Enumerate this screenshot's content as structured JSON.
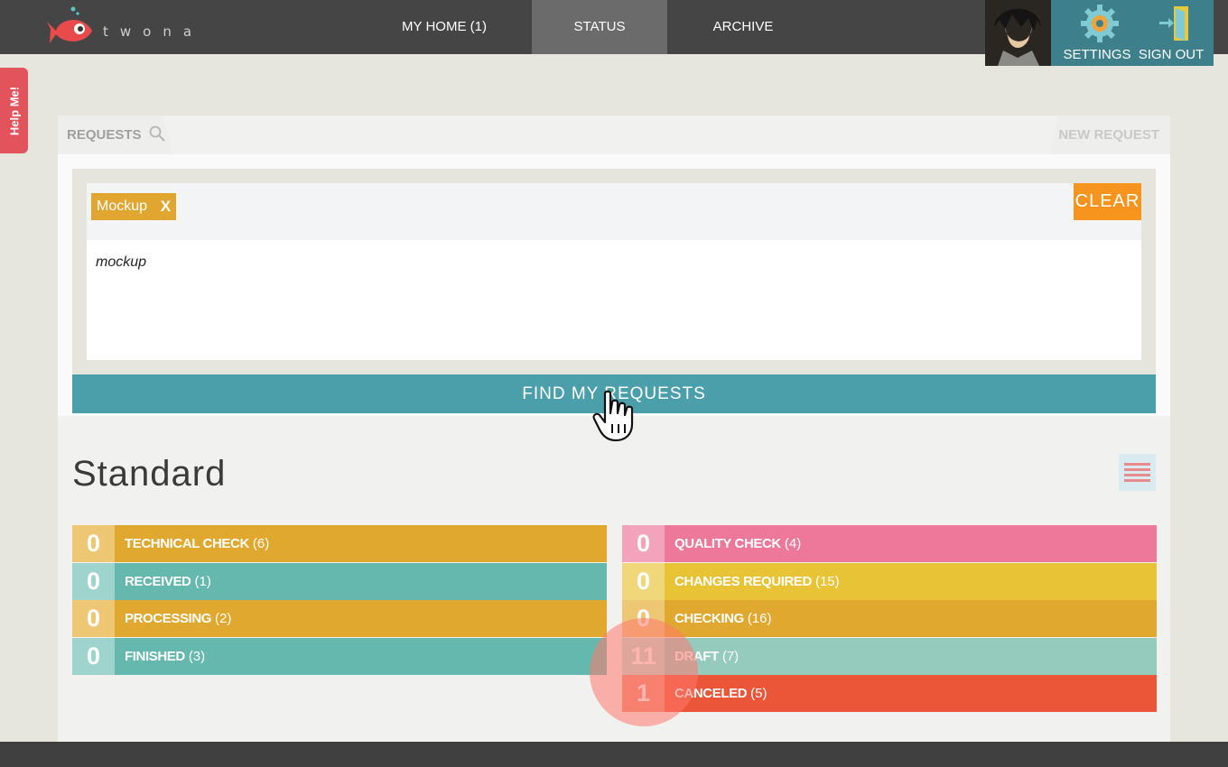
{
  "brand": {
    "name": "twona"
  },
  "nav": [
    {
      "label": "MY HOME (1)"
    },
    {
      "label": "STATUS"
    },
    {
      "label": "ARCHIVE"
    }
  ],
  "user_menu": {
    "settings": "SETTINGS",
    "sign_out": "SIGN OUT"
  },
  "help_tab": "Help Me!",
  "tabs": {
    "requests": "REQUESTS",
    "new_request": "NEW REQUEST"
  },
  "search": {
    "tag": "Mockup",
    "tag_remove": "X",
    "clear_label": "CLEAR",
    "query": "mockup",
    "find_label": "FIND MY REQUESTS"
  },
  "section_title": "Standard",
  "statuses_left": [
    {
      "count": "0",
      "name": "TECHNICAL CHECK",
      "total": "(6)",
      "color": "#e0a82e",
      "count_color": "#eec774"
    },
    {
      "count": "0",
      "name": "RECEIVED",
      "total": "(1)",
      "color": "#64b8ad",
      "count_color": "#9ed4cd"
    },
    {
      "count": "0",
      "name": "PROCESSING",
      "total": "(2)",
      "color": "#e0a82e",
      "count_color": "#eec774"
    },
    {
      "count": "0",
      "name": "FINISHED",
      "total": "(3)",
      "color": "#64b8ad",
      "count_color": "#9ed4cd"
    }
  ],
  "statuses_right": [
    {
      "count": "0",
      "name": "QUALITY CHECK",
      "total": "(4)",
      "color": "#ee7899",
      "count_color": "#f3a3bb"
    },
    {
      "count": "0",
      "name": "CHANGES REQUIRED",
      "total": "(15)",
      "color": "#e8c335",
      "count_color": "#f0d87a"
    },
    {
      "count": "0",
      "name": "CHECKING",
      "total": "(16)",
      "color": "#e0a82e",
      "count_color": "#eec774"
    },
    {
      "count": "11",
      "name": "DRAFT",
      "total": "(7)",
      "color": "#95cbbd",
      "count_color": "#b9ddd4"
    },
    {
      "count": "1",
      "name": "CANCELED",
      "total": "(5)",
      "color": "#ea5637",
      "count_color": "#ef8a72"
    }
  ]
}
